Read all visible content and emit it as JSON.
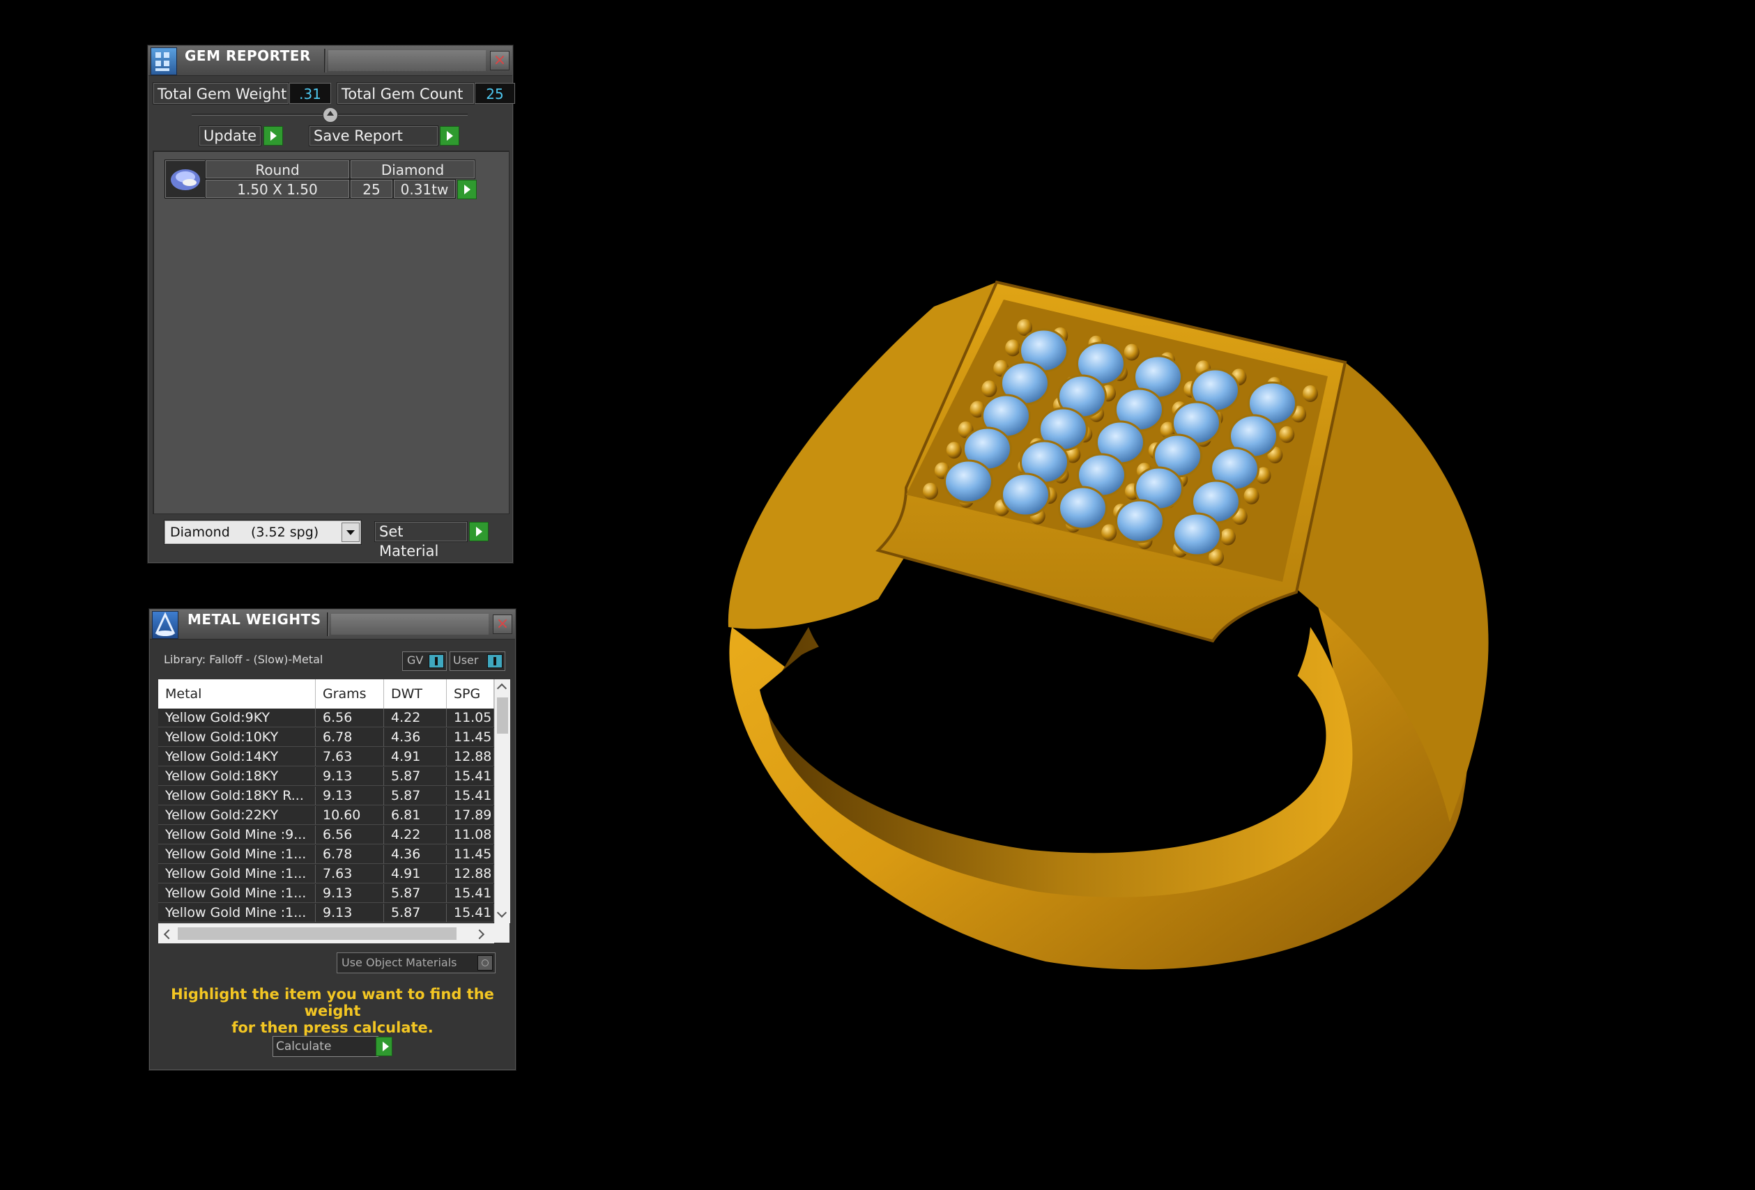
{
  "gem_reporter": {
    "title": "GEM REPORTER",
    "total_gem_weight_label": "Total Gem Weight",
    "total_gem_weight_value": ".31",
    "total_gem_count_label": "Total Gem Count",
    "total_gem_count_value": "25",
    "update_label": "Update",
    "save_report_label": "Save Report",
    "gem_row": {
      "shape": "Round",
      "stone": "Diamond",
      "size": "1.50 X 1.50",
      "count": "25",
      "weight": "0.31tw"
    },
    "material_select_value": "Diamond     (3.52 spg)",
    "set_material_label": "Set Material"
  },
  "metal_weights": {
    "title": "METAL WEIGHTS",
    "library_label": "Library: Falloff - (Slow)-Metal",
    "toggle_gv": "GV",
    "toggle_user": "User",
    "columns": [
      "Metal",
      "Grams",
      "DWT",
      "SPG"
    ],
    "rows": [
      [
        "Yellow Gold:9KY",
        "6.56",
        "4.22",
        "11.05"
      ],
      [
        "Yellow Gold:10KY",
        "6.78",
        "4.36",
        "11.45"
      ],
      [
        "Yellow Gold:14KY",
        "7.63",
        "4.91",
        "12.88"
      ],
      [
        "Yellow Gold:18KY",
        "9.13",
        "5.87",
        "15.41"
      ],
      [
        "Yellow Gold:18KY R...",
        "9.13",
        "5.87",
        "15.41"
      ],
      [
        "Yellow Gold:22KY",
        "10.60",
        "6.81",
        "17.89"
      ],
      [
        "Yellow Gold Mine :9...",
        "6.56",
        "4.22",
        "11.08"
      ],
      [
        "Yellow Gold Mine :1...",
        "6.78",
        "4.36",
        "11.45"
      ],
      [
        "Yellow Gold Mine :1...",
        "7.63",
        "4.91",
        "12.88"
      ],
      [
        "Yellow Gold Mine :1...",
        "9.13",
        "5.87",
        "15.41"
      ],
      [
        "Yellow Gold Mine :1...",
        "9.13",
        "5.87",
        "15.41"
      ]
    ],
    "use_object_materials_label": "Use Object Materials",
    "hint_line1": "Highlight the item you want to find the weight",
    "hint_line2": "for then press calculate.",
    "calculate_label": "Calculate"
  },
  "colors": {
    "gold": "#d99a12",
    "gem_blue": "#7fb4e8",
    "accent_green": "#2f9a2f",
    "hint_yellow": "#f3c623",
    "value_cyan": "#4ec8f0"
  }
}
